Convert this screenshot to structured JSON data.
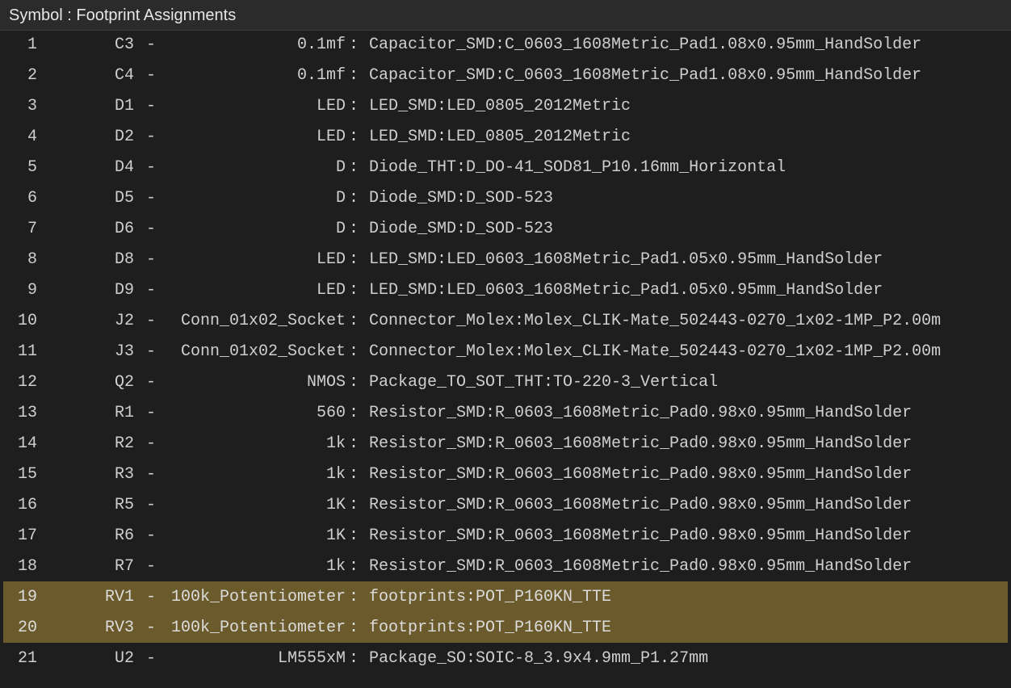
{
  "header": {
    "title": "Symbol : Footprint Assignments"
  },
  "separator_dash": "-",
  "separator_colon": ":",
  "rows": [
    {
      "num": "1",
      "ref": "C3",
      "value": "0.1mf",
      "footprint": "Capacitor_SMD:C_0603_1608Metric_Pad1.08x0.95mm_HandSolder",
      "selected": false
    },
    {
      "num": "2",
      "ref": "C4",
      "value": "0.1mf",
      "footprint": "Capacitor_SMD:C_0603_1608Metric_Pad1.08x0.95mm_HandSolder",
      "selected": false
    },
    {
      "num": "3",
      "ref": "D1",
      "value": "LED",
      "footprint": "LED_SMD:LED_0805_2012Metric",
      "selected": false
    },
    {
      "num": "4",
      "ref": "D2",
      "value": "LED",
      "footprint": "LED_SMD:LED_0805_2012Metric",
      "selected": false
    },
    {
      "num": "5",
      "ref": "D4",
      "value": "D",
      "footprint": "Diode_THT:D_DO-41_SOD81_P10.16mm_Horizontal",
      "selected": false
    },
    {
      "num": "6",
      "ref": "D5",
      "value": "D",
      "footprint": "Diode_SMD:D_SOD-523",
      "selected": false
    },
    {
      "num": "7",
      "ref": "D6",
      "value": "D",
      "footprint": "Diode_SMD:D_SOD-523",
      "selected": false
    },
    {
      "num": "8",
      "ref": "D8",
      "value": "LED",
      "footprint": "LED_SMD:LED_0603_1608Metric_Pad1.05x0.95mm_HandSolder",
      "selected": false
    },
    {
      "num": "9",
      "ref": "D9",
      "value": "LED",
      "footprint": "LED_SMD:LED_0603_1608Metric_Pad1.05x0.95mm_HandSolder",
      "selected": false
    },
    {
      "num": "10",
      "ref": "J2",
      "value": "Conn_01x02_Socket",
      "footprint": "Connector_Molex:Molex_CLIK-Mate_502443-0270_1x02-1MP_P2.00m",
      "selected": false
    },
    {
      "num": "11",
      "ref": "J3",
      "value": "Conn_01x02_Socket",
      "footprint": "Connector_Molex:Molex_CLIK-Mate_502443-0270_1x02-1MP_P2.00m",
      "selected": false
    },
    {
      "num": "12",
      "ref": "Q2",
      "value": "NMOS",
      "footprint": "Package_TO_SOT_THT:TO-220-3_Vertical",
      "selected": false
    },
    {
      "num": "13",
      "ref": "R1",
      "value": "560",
      "footprint": "Resistor_SMD:R_0603_1608Metric_Pad0.98x0.95mm_HandSolder",
      "selected": false
    },
    {
      "num": "14",
      "ref": "R2",
      "value": "1k",
      "footprint": "Resistor_SMD:R_0603_1608Metric_Pad0.98x0.95mm_HandSolder",
      "selected": false
    },
    {
      "num": "15",
      "ref": "R3",
      "value": "1k",
      "footprint": "Resistor_SMD:R_0603_1608Metric_Pad0.98x0.95mm_HandSolder",
      "selected": false
    },
    {
      "num": "16",
      "ref": "R5",
      "value": "1K",
      "footprint": "Resistor_SMD:R_0603_1608Metric_Pad0.98x0.95mm_HandSolder",
      "selected": false
    },
    {
      "num": "17",
      "ref": "R6",
      "value": "1K",
      "footprint": "Resistor_SMD:R_0603_1608Metric_Pad0.98x0.95mm_HandSolder",
      "selected": false
    },
    {
      "num": "18",
      "ref": "R7",
      "value": "1k",
      "footprint": "Resistor_SMD:R_0603_1608Metric_Pad0.98x0.95mm_HandSolder",
      "selected": false
    },
    {
      "num": "19",
      "ref": "RV1",
      "value": "100k_Potentiometer",
      "footprint": "footprints:POT_P160KN_TTE",
      "selected": true
    },
    {
      "num": "20",
      "ref": "RV3",
      "value": "100k_Potentiometer",
      "footprint": "footprints:POT_P160KN_TTE",
      "selected": true
    },
    {
      "num": "21",
      "ref": "U2",
      "value": "LM555xM",
      "footprint": "Package_SO:SOIC-8_3.9x4.9mm_P1.27mm",
      "selected": false
    }
  ],
  "colors": {
    "background": "#1e1e1e",
    "header_background": "#2b2b2b",
    "text": "#cfcfcf",
    "selection": "#6b5b2c"
  }
}
